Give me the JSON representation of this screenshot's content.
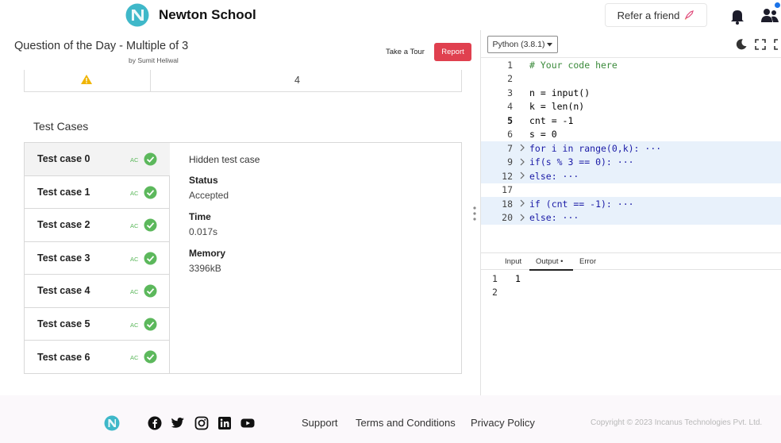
{
  "header": {
    "brand": "Newton School",
    "refer_label": "Refer a friend"
  },
  "question": {
    "title": "Question of the Day - Multiple of 3",
    "author": "by Sumit Heliwal",
    "tour_label": "Take a Tour",
    "report_label": "Report",
    "prev_value": "4"
  },
  "test_cases": {
    "heading": "Test Cases",
    "items": [
      {
        "name": "Test case 0",
        "status": "AC"
      },
      {
        "name": "Test case 1",
        "status": "AC"
      },
      {
        "name": "Test case 2",
        "status": "AC"
      },
      {
        "name": "Test case 3",
        "status": "AC"
      },
      {
        "name": "Test case 4",
        "status": "AC"
      },
      {
        "name": "Test case 5",
        "status": "AC"
      },
      {
        "name": "Test case 6",
        "status": "AC"
      }
    ],
    "selected": 0,
    "detail": {
      "hidden": "Hidden test case",
      "status_label": "Status",
      "status_value": "Accepted",
      "time_label": "Time",
      "time_value": "0.017s",
      "memory_label": "Memory",
      "memory_value": "3396kB"
    }
  },
  "editor": {
    "language": "Python (3.8.1)",
    "lines": [
      {
        "n": "1",
        "text": "# Your code here"
      },
      {
        "n": "2",
        "text": ""
      },
      {
        "n": "3",
        "text": "n = input()"
      },
      {
        "n": "4",
        "text": "k = len(n)"
      },
      {
        "n": "5",
        "text": "cnt = -1"
      },
      {
        "n": "6",
        "text": "s = 0"
      },
      {
        "n": "7",
        "text": "for i in range(0,k): ···"
      },
      {
        "n": "9",
        "text": "if(s % 3 == 0): ···"
      },
      {
        "n": "12",
        "text": "else: ···"
      },
      {
        "n": "17",
        "text": ""
      },
      {
        "n": "18",
        "text": "if (cnt == -1): ···"
      },
      {
        "n": "20",
        "text": "else: ···"
      }
    ]
  },
  "output": {
    "tabs": [
      "Input",
      "Output •",
      "Error"
    ],
    "lines": [
      {
        "n": "1",
        "text": "1"
      },
      {
        "n": "2",
        "text": ""
      }
    ]
  },
  "footer": {
    "links": [
      "Support",
      "Terms and Conditions",
      "Privacy Policy"
    ],
    "copyright": "Copyright © 2023 Incanus Technologies Pvt. Ltd."
  },
  "colors": {
    "report": "#e0404f",
    "accepted": "#5cb85c",
    "editor_highlight": "#e8f1fb"
  }
}
